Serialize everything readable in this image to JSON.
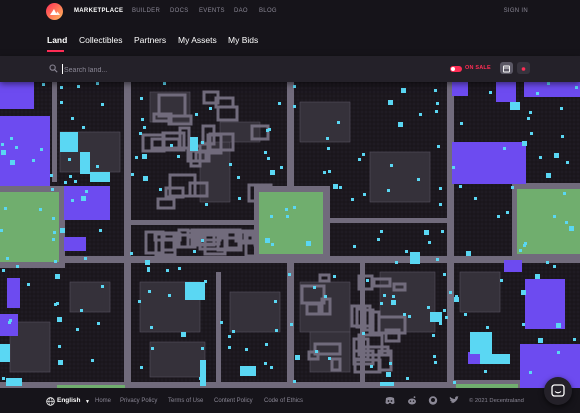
{
  "nav": {
    "brand": "MARKETPLACE",
    "links": [
      "BUILDER",
      "DOCS",
      "EVENTS",
      "DAO",
      "BLOG"
    ],
    "signin": "SIGN IN"
  },
  "tabs": [
    "Land",
    "Collectibles",
    "Partners",
    "My Assets",
    "My Bids"
  ],
  "active_tab": "Land",
  "search": {
    "placeholder": "Search land...",
    "value": ""
  },
  "filter": {
    "on_sale_label": "ON SALE",
    "on_sale_enabled": true
  },
  "view_toggle": [
    "map-view-icon",
    "list-view-icon"
  ],
  "map": {
    "tile_colors": {
      "background": "#18141a",
      "road": "#716b7c",
      "plaza": "#70ae6e",
      "district": "#6d4bf0",
      "on_sale": "#5ad7f3",
      "estate": "#35313a"
    }
  },
  "footer": {
    "language": "English",
    "links": [
      "Home",
      "Privacy Policy",
      "Terms of Use",
      "Content Policy",
      "Code of Ethics"
    ],
    "social_icons": [
      "discord-icon",
      "reddit-icon",
      "github-icon",
      "twitter-icon"
    ],
    "copyright": "© 2021 Decentraland"
  },
  "colors": {
    "accent": "#ff2d55",
    "text_muted": "#8a8795",
    "background": "#16141a"
  }
}
